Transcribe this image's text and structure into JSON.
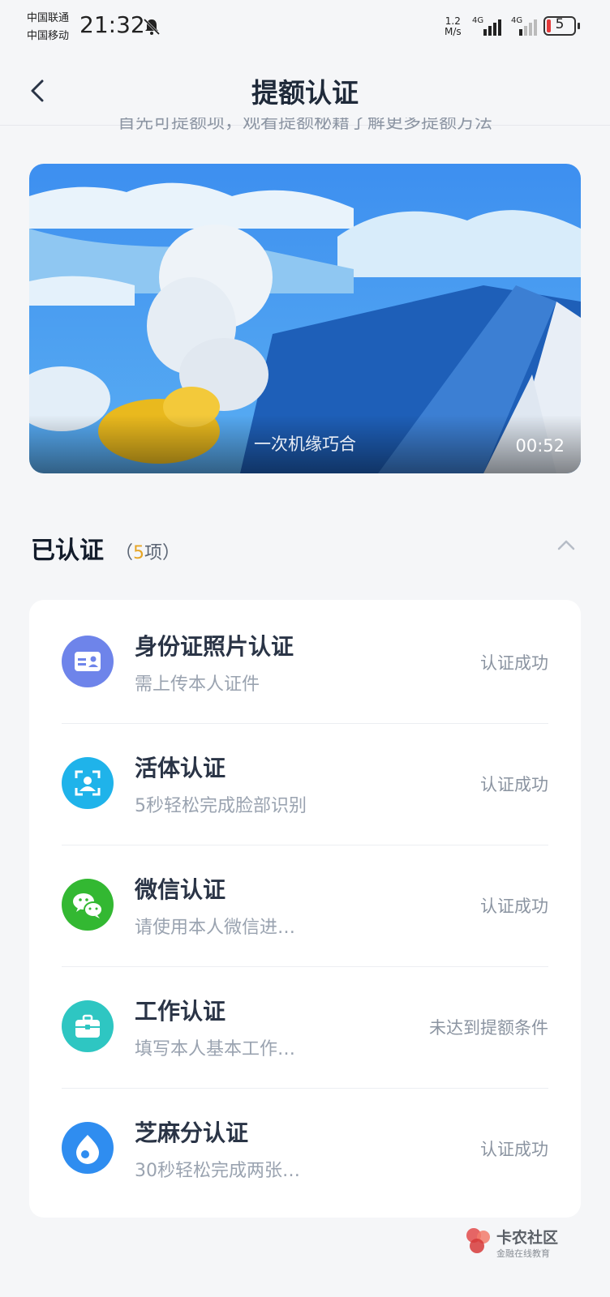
{
  "status_bar": {
    "carrier1": "中国联通",
    "carrier2": "中国移动",
    "time": "21:32",
    "net_speed_value": "1.2",
    "net_speed_unit": "M/s",
    "net_type1": "4G",
    "net_type2": "4G",
    "battery": "5"
  },
  "nav": {
    "title": "提额认证"
  },
  "hint": "首先可提额项，观看提额秘籍了解更多提额方法",
  "video": {
    "caption": "一次机缘巧合",
    "duration": "00:52"
  },
  "section": {
    "title": "已认证",
    "count_open": "（",
    "count_num": "5",
    "count_unit": "项）"
  },
  "items": [
    {
      "title": "身份证照片认证",
      "subtitle": "需上传本人证件",
      "status": "认证成功",
      "icon": "id-card-icon",
      "color": "#6e84ea"
    },
    {
      "title": "活体认证",
      "subtitle": "5秒轻松完成脸部识别",
      "status": "认证成功",
      "icon": "face-scan-icon",
      "color": "#1fb3ea"
    },
    {
      "title": "微信认证",
      "subtitle": "请使用本人微信进…",
      "status": "认证成功",
      "icon": "wechat-icon",
      "color": "#33b832"
    },
    {
      "title": "工作认证",
      "subtitle": "填写本人基本工作…",
      "status": "未达到提额条件",
      "icon": "briefcase-icon",
      "color": "#2ec6c2"
    },
    {
      "title": "芝麻分认证",
      "subtitle": "30秒轻松完成两张…",
      "status": "认证成功",
      "icon": "sesame-icon",
      "color": "#2f8df0"
    }
  ],
  "watermark": {
    "name": "卡农社区",
    "tagline": "金融在线教育"
  }
}
